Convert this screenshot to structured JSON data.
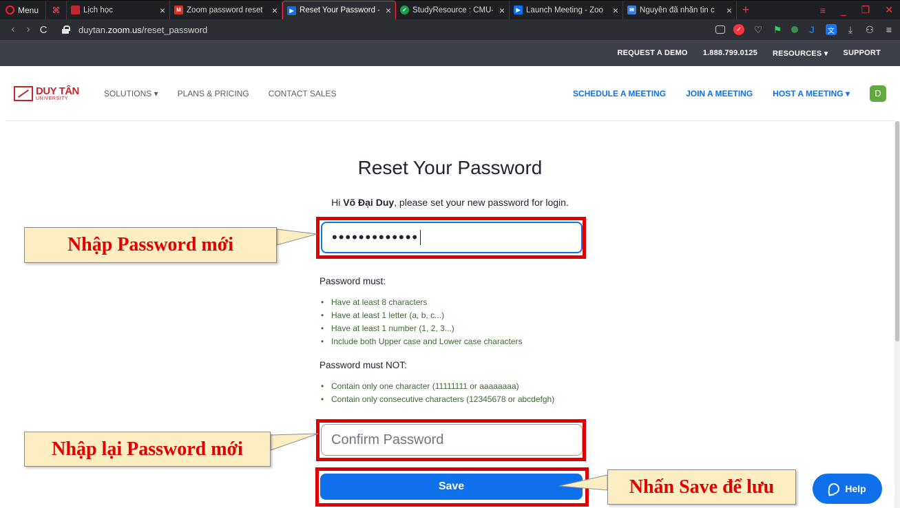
{
  "browser": {
    "menu_label": "Menu",
    "tabs": [
      {
        "title": "Lịch học",
        "color": "#c1272d"
      },
      {
        "title": "Zoom password reset",
        "color": "#d93025"
      },
      {
        "title": "Reset Your Password -",
        "color": "#0e71eb",
        "active": true
      },
      {
        "title": "StudyResource : CMU-",
        "color": "#1a9e4b"
      },
      {
        "title": "Launch Meeting - Zoo",
        "color": "#0e71eb"
      },
      {
        "title": "Nguyễn đã nhắn tin c",
        "color": "#3b7ddd"
      }
    ],
    "url_host_prefix": "duytan.",
    "url_host_bold": "zoom.us",
    "url_path": "/reset_password"
  },
  "zoom_top": {
    "request_demo": "REQUEST A DEMO",
    "phone": "1.888.799.0125",
    "resources": "RESOURCES ▾",
    "support": "SUPPORT"
  },
  "nav": {
    "logo_main": "DUY TÂN",
    "logo_sub": "UNIVERSITY",
    "solutions": "SOLUTIONS",
    "plans_pricing": "PLANS & PRICING",
    "contact_sales": "CONTACT SALES",
    "schedule_meeting": "SCHEDULE A MEETING",
    "join_meeting": "JOIN A MEETING",
    "host_meeting": "HOST A MEETING ▾",
    "avatar_initial": "D"
  },
  "form": {
    "title": "Reset Your Password",
    "greeting_prefix": "Hi ",
    "user_name": "Võ Đại Duy",
    "greeting_suffix": ", please set your new password for login.",
    "password_value": "•••••••••••••",
    "must_heading": "Password must:",
    "must_items": [
      "Have at least 8 characters",
      "Have at least 1 letter (a, b, c...)",
      "Have at least 1 number (1, 2, 3...)",
      "Include both Upper case and Lower case characters"
    ],
    "must_not_heading": "Password must NOT:",
    "must_not_items": [
      "Contain only one character (11111111 or aaaaaaaa)",
      "Contain only consecutive characters (12345678 or abcdefgh)"
    ],
    "confirm_placeholder": "Confirm Password",
    "save_label": "Save"
  },
  "annotations": {
    "new_password": "Nhập Password mới",
    "confirm_password": "Nhập lại Password mới",
    "save": "Nhấn Save để lưu"
  },
  "help_label": "Help",
  "colors": {
    "zoom_blue": "#0e71eb",
    "highlight_red": "#e00000",
    "callout_bg": "#fdedc2"
  }
}
